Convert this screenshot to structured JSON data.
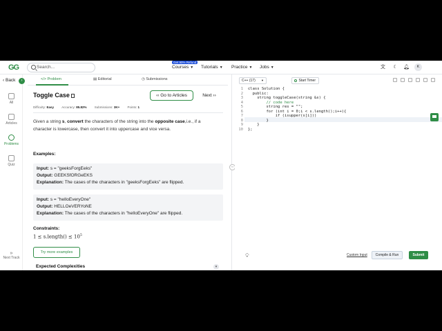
{
  "nav": {
    "logo": "GG",
    "search_placeholder": "Search...",
    "promo_badge": "Get 90% Refund",
    "links": [
      "Courses",
      "Tutorials",
      "Practice",
      "Jobs"
    ],
    "avatar_initial": "K"
  },
  "rail": {
    "back_label": "Back",
    "items": [
      "All",
      "Articles",
      "Problems",
      "Quiz"
    ],
    "next_track": "Next Track"
  },
  "problem": {
    "tabs": [
      "Problem",
      "Editorial",
      "Submissions"
    ],
    "title": "Toggle Case",
    "goto_articles": "Go to Articles",
    "next": "Next",
    "difficulty_label": "Difficulty:",
    "difficulty": "Easy",
    "accuracy_label": "Accuracy:",
    "accuracy": "85.82%",
    "submissions_label": "Submissions:",
    "submissions": "3K+",
    "points_label": "Points:",
    "points": "1",
    "description": {
      "p1": "Given a string ",
      "var_s": "s",
      "p2": ", ",
      "convert": "convert",
      "p3": " the characters of the string into the ",
      "opposite": "opposite case",
      "p4": ",i.e., if a character is lowercase, then convert it into uppercase and vice versa."
    },
    "examples_heading": "Examples:",
    "examples": [
      {
        "input_label": "Input:",
        "input": "s = \"geeksForgEeks\"",
        "output_label": "Output:",
        "output": "GEEKSfORGeEKS",
        "explanation_label": "Explanation:",
        "explanation": "The cases of the characters in \"geeksForgEeks\" are flipped."
      },
      {
        "input_label": "Input:",
        "input": "s = \"heIloEveryOne\"",
        "output_label": "Output:",
        "output": "HELLOeVERYoNE",
        "explanation_label": "Explanation:",
        "explanation": "The cases of the characters in \"heIloEveryOne\" are flipped."
      }
    ],
    "constraints_heading": "Constraints:",
    "constraint_base": "1 ≤ s.length() ≤ 10",
    "constraint_exp": "5",
    "try_more": "Try more examples",
    "expected_complexities": "Expected Complexities"
  },
  "editor": {
    "language": "C++ (17)",
    "start_timer": "Start Timer",
    "line_numbers": [
      "1",
      "2",
      "3",
      "4",
      "5",
      "6",
      "7",
      "8",
      "9",
      "10"
    ],
    "lines": [
      "class Solution {",
      "  public:",
      "    string toggleCase(string &s) {",
      "        // code here",
      "        string res = \"\";",
      "        for (int i = 0;i < s.length();i++){",
      "            if (isupper(s[i]))",
      "        }",
      "    }",
      "};"
    ],
    "custom_input": "Custom Input",
    "compile_run": "Compile & Run",
    "submit": "Submit"
  }
}
